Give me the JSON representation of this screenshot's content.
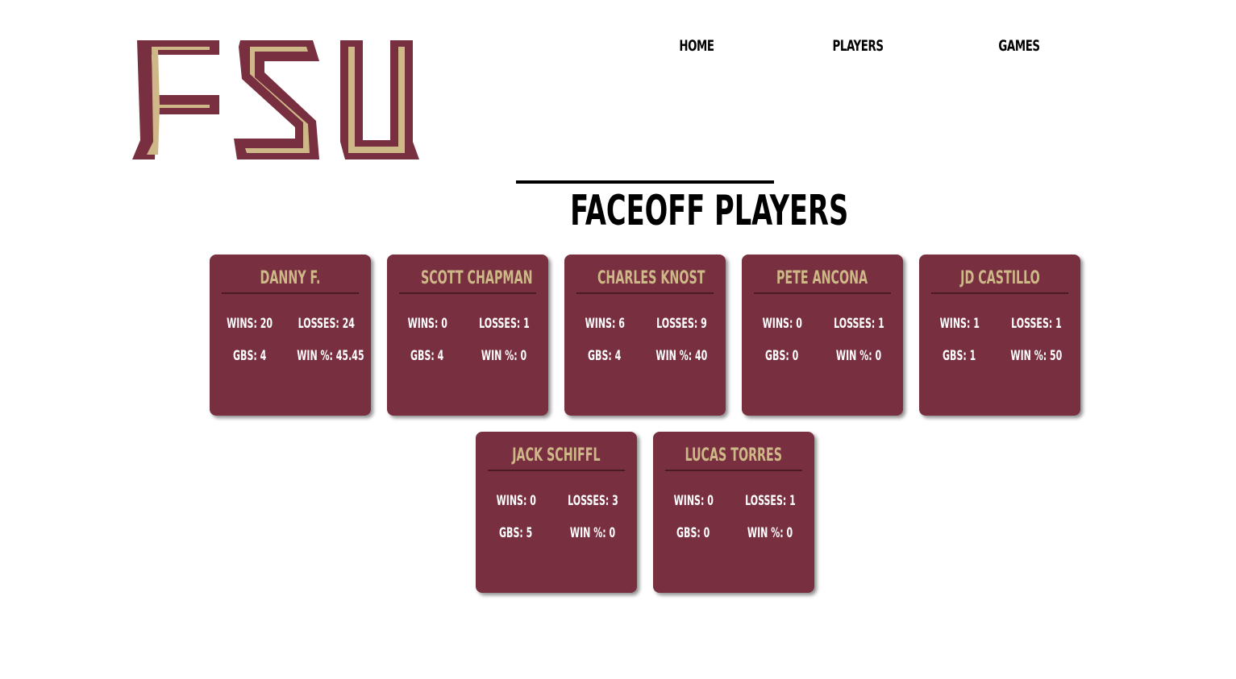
{
  "logo": {
    "text": "FSU",
    "colors": {
      "outer": "#782f40",
      "inner": "#ceb888"
    }
  },
  "nav": {
    "items": [
      {
        "label": "HOME",
        "active": false
      },
      {
        "label": "PLAYERS",
        "active": true
      },
      {
        "label": "GAMES",
        "active": false
      }
    ]
  },
  "page": {
    "title": "FACEOFF PLAYERS"
  },
  "colors": {
    "card_bg": "#782f40",
    "card_name": "#ceb888",
    "card_text": "#ffffff"
  },
  "players": [
    {
      "name": "DANNY F.",
      "wins": "WINS: 20",
      "losses": "LOSSES: 24",
      "gbs": "GBS: 4",
      "win_pct": "WIN %: 45.45"
    },
    {
      "name": "SCOTT CHAPMAN",
      "wins": "WINS: 0",
      "losses": "LOSSES: 1",
      "gbs": "GBS: 4",
      "win_pct": "WIN %: 0"
    },
    {
      "name": "CHARLES KNOST",
      "wins": "WINS: 6",
      "losses": "LOSSES: 9",
      "gbs": "GBS: 4",
      "win_pct": "WIN %: 40"
    },
    {
      "name": "PETE ANCONA",
      "wins": "WINS: 0",
      "losses": "LOSSES: 1",
      "gbs": "GBS: 0",
      "win_pct": "WIN %: 0"
    },
    {
      "name": "JD CASTILLO",
      "wins": "WINS: 1",
      "losses": "LOSSES: 1",
      "gbs": "GBS: 1",
      "win_pct": "WIN %: 50"
    },
    {
      "name": "JACK SCHIFFL",
      "wins": "WINS: 0",
      "losses": "LOSSES: 3",
      "gbs": "GBS: 5",
      "win_pct": "WIN %: 0"
    },
    {
      "name": "LUCAS TORRES",
      "wins": "WINS: 0",
      "losses": "LOSSES: 1",
      "gbs": "GBS: 0",
      "win_pct": "WIN %: 0"
    }
  ]
}
